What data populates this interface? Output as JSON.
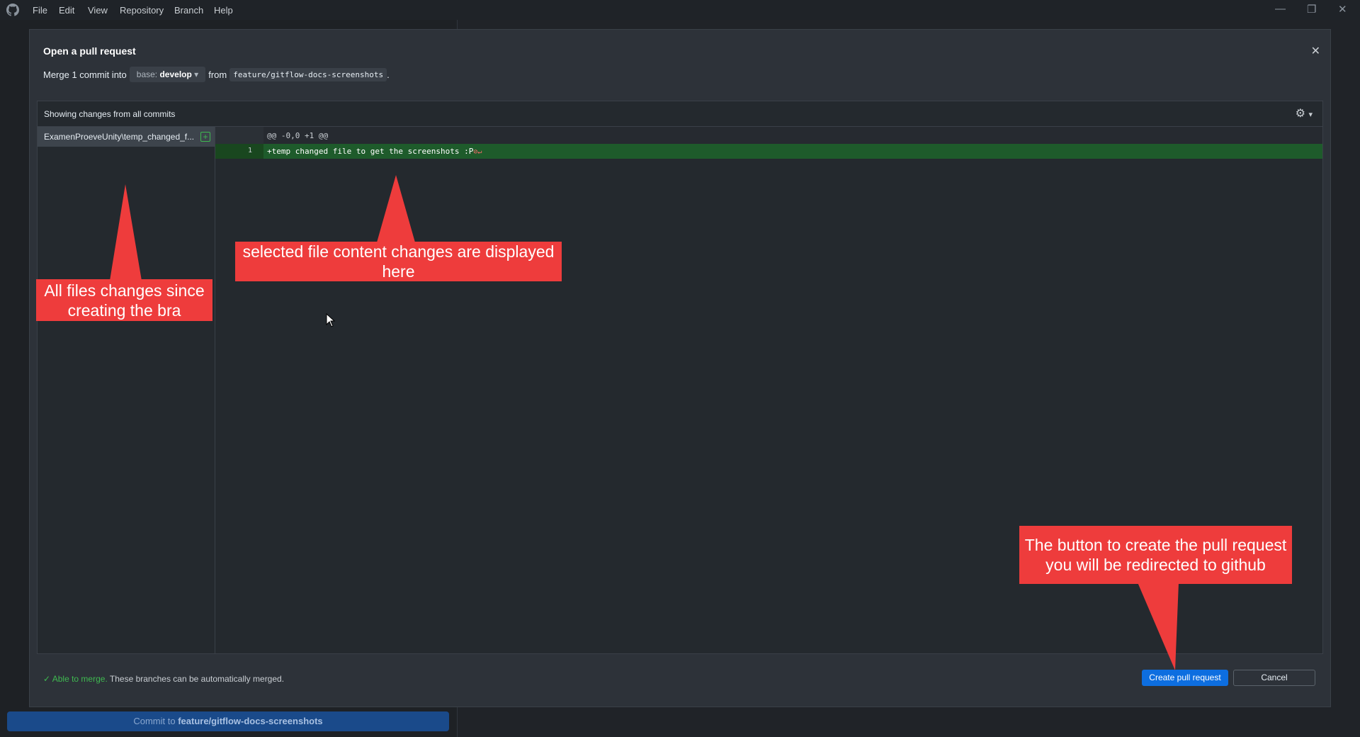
{
  "menu": {
    "items": [
      "File",
      "Edit",
      "View",
      "Repository",
      "Branch",
      "Help"
    ]
  },
  "window_controls": {
    "minimize": "—",
    "restore": "❐",
    "close": "✕"
  },
  "background": {
    "commit_prefix": "Commit to ",
    "commit_branch": "feature/gitflow-docs-screenshots"
  },
  "dialog": {
    "title": "Open a pull request",
    "close_glyph": "✕",
    "merge_prefix": "Merge 1 commit into",
    "base_label": "base:",
    "base_branch": "develop",
    "from_label": "from",
    "head_branch": "feature/gitflow-docs-screenshots",
    "period": "."
  },
  "diff": {
    "header_label": "Showing changes from all commits",
    "files": [
      {
        "name": "ExamenProeveUnity\\temp_changed_f...",
        "status": "added"
      }
    ],
    "hunk_header": "@@ -0,0 +1 @@",
    "lines": [
      {
        "number": "1",
        "text": "+temp changed file to get the screenshots :P"
      }
    ],
    "eol_marker": "⊘↵"
  },
  "annotations": {
    "file_list": "All files changes since creating the bra",
    "diff_content": "selected file content changes are displayed here",
    "create_button": "The button to create the pull request you will be redirected to github"
  },
  "footer": {
    "able_label": "Able to merge.",
    "merge_message": "These branches can be automatically merged.",
    "create_button": "Create pull request",
    "cancel_button": "Cancel"
  },
  "colors": {
    "annotation": "#ee3c3c",
    "primary_button": "#0d6ee0",
    "added_line": "#1e5b2b",
    "success": "#3fb950"
  }
}
